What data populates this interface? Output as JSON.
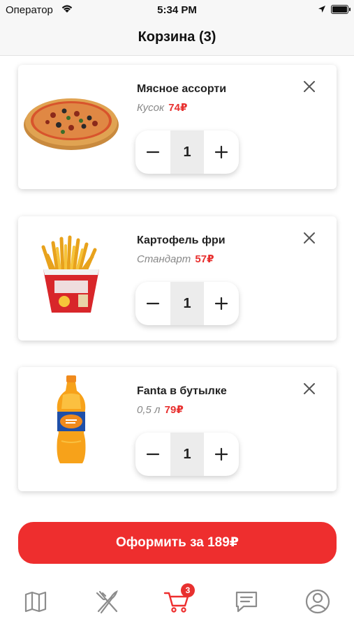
{
  "status_bar": {
    "carrier": "Оператор",
    "time": "5:34 PM"
  },
  "header": {
    "title": "Корзина (3)"
  },
  "cart": {
    "items": [
      {
        "name": "Мясное ассорти",
        "variant": "Кусок",
        "price": "74₽",
        "quantity": "1",
        "image": "pizza"
      },
      {
        "name": "Картофель фри",
        "variant": "Стандарт",
        "price": "57₽",
        "quantity": "1",
        "image": "french-fries"
      },
      {
        "name": "Fanta в бутылке",
        "variant": "0,5 л",
        "price": "79₽",
        "quantity": "1",
        "image": "fanta-bottle"
      }
    ],
    "remove_icon": "close-icon",
    "minus_icon": "minus-icon",
    "plus_icon": "plus-icon"
  },
  "checkout": {
    "label": "Оформить за 189₽"
  },
  "tab_bar": {
    "tabs": [
      {
        "icon": "map-icon",
        "active": false
      },
      {
        "icon": "fork-knife-icon",
        "active": false
      },
      {
        "icon": "cart-icon",
        "active": true,
        "badge": "3"
      },
      {
        "icon": "chat-icon",
        "active": false
      },
      {
        "icon": "profile-icon",
        "active": false
      }
    ]
  },
  "colors": {
    "accent": "#ee2e2e",
    "price": "#e8302f",
    "inactive_icon": "#8c8c8c"
  }
}
